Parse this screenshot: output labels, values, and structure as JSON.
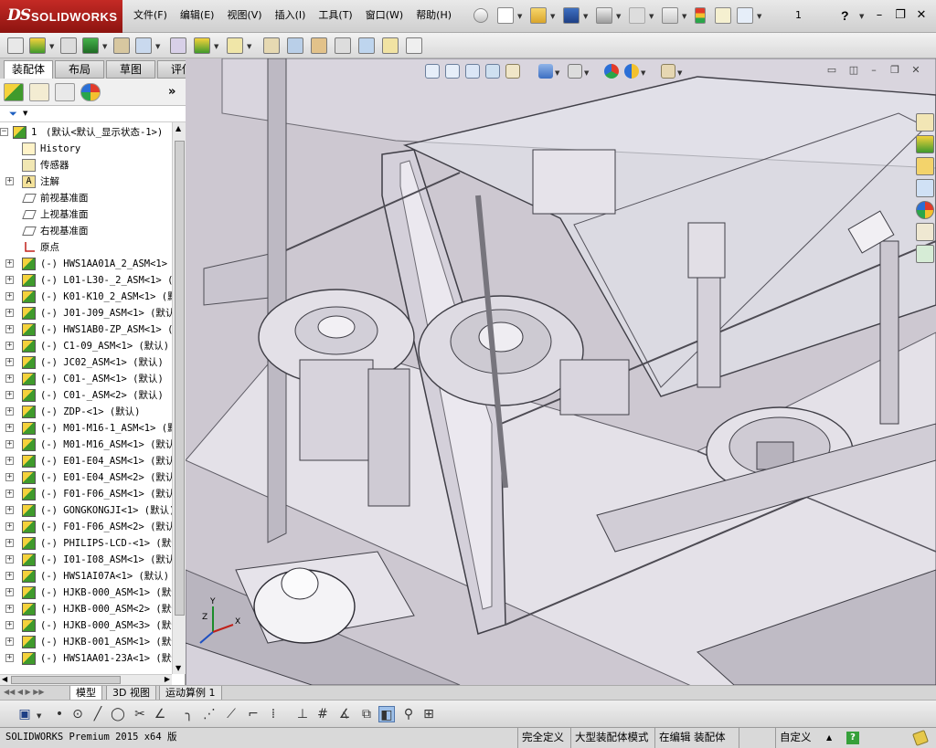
{
  "app": {
    "brand_prefix": "DS",
    "brand_name": "SOLIDWORKS"
  },
  "menu": [
    "文件(F)",
    "编辑(E)",
    "视图(V)",
    "插入(I)",
    "工具(T)",
    "窗口(W)",
    "帮助(H)"
  ],
  "toolbar": {
    "config_number": "1",
    "help_label": "?"
  },
  "panel_tabs": [
    "装配体",
    "布局",
    "草图",
    "评估"
  ],
  "panel_tools": {
    "more_label": "»"
  },
  "tree": {
    "root_index": "1",
    "root_label": "(默认<默认_显示状态-1>)",
    "fixed_items": [
      "History",
      "传感器",
      "注解",
      "前视基准面",
      "上视基准面",
      "右视基准面",
      "原点"
    ],
    "components": [
      "(-) HWS1AA01A_2_ASM<1> (",
      "(-) L01-L30-_2_ASM<1> (默",
      "(-) K01-K10_2_ASM<1> (默认",
      "(-) J01-J09_ASM<1> (默认)",
      "(-) HWS1AB0-ZP_ASM<1> (默",
      "(-) C1-09_ASM<1> (默认)",
      "(-) JC02_ASM<1> (默认)",
      "(-) C01-_ASM<1> (默认)",
      "(-) C01-_ASM<2> (默认)",
      "(-) ZDP-<1> (默认)",
      "(-) M01-M16-1_ASM<1> (默",
      "(-) M01-M16_ASM<1> (默认",
      "(-) E01-E04_ASM<1> (默认",
      "(-) E01-E04_ASM<2> (默认",
      "(-) F01-F06_ASM<1> (默认",
      "(-) GONGKONGJI<1> (默认)",
      "(-) F01-F06_ASM<2> (默认",
      "(-) PHILIPS-LCD-<1> (默认",
      "(-) I01-I08_ASM<1> (默认",
      "(-) HWS1AI07A<1> (默认)",
      "(-) HJKB-000_ASM<1> (默认",
      "(-) HJKB-000_ASM<2> (默认",
      "(-) HJKB-000_ASM<3> (默认",
      "(-) HJKB-001_ASM<1> (默认",
      "(-) HWS1AA01-23A<1> (默认"
    ]
  },
  "bottom_tabs": [
    "模型",
    "3D 视图",
    "运动算例 1"
  ],
  "status": {
    "product": "SOLIDWORKS Premium 2015 x64 版",
    "define_state": "完全定义",
    "mode": "大型装配体模式",
    "editing": "在编辑 装配体",
    "units": "自定义",
    "units_arrow": "▲",
    "help": "?"
  },
  "axis_labels": {
    "x": "X",
    "y": "Y",
    "z": "Z"
  },
  "colors": {
    "brand_red": "#b01d18",
    "viewport_bg": "#c8c3cc",
    "tab_active": "#ffffff"
  },
  "icons": {
    "tree_history": "history-icon",
    "tree_sensors": "sensor-icon",
    "tree_annotations": "annotation-icon",
    "tree_plane": "plane-icon",
    "tree_origin": "origin-icon",
    "tree_assembly": "assembly-icon"
  }
}
